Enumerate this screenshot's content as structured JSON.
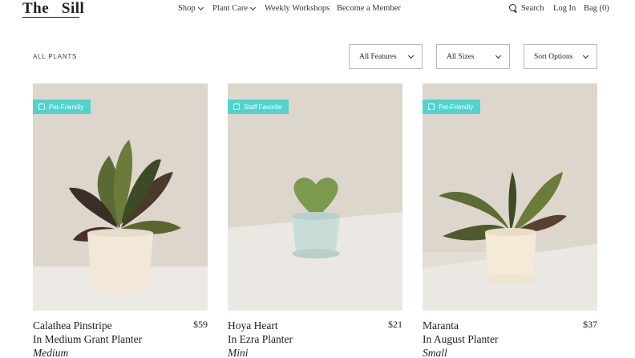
{
  "header": {
    "logo": "The   Sill",
    "nav": [
      {
        "label": "Shop"
      },
      {
        "label": "Plant Care"
      },
      {
        "label": "Weekly Workshops"
      },
      {
        "label": "Become a Member"
      }
    ],
    "search_label": "Search",
    "login_label": "Log In",
    "bag_label": "Bag (0)"
  },
  "breadcrumb": "ALL PLANTS",
  "filters": {
    "features": "All Features",
    "sizes": "All Sizes",
    "sort": "Sort Options"
  },
  "products": [
    {
      "badge": "Pet-Friendly",
      "name_line1": "Calathea Pinstripe",
      "name_line2": "In Medium Grant Planter",
      "size": "Medium",
      "price": "$59"
    },
    {
      "badge": "Staff Favorite",
      "name_line1": "Hoya Heart",
      "name_line2": "In Ezra Planter",
      "size": "Mini",
      "price": "$21"
    },
    {
      "badge": "Pet-Friendly",
      "name_line1": "Maranta",
      "name_line2": "In August Planter",
      "size": "Small",
      "price": "$37"
    }
  ],
  "colors": {
    "badge": "#4fd4cc",
    "photo_bg": "#e3ddd5"
  }
}
